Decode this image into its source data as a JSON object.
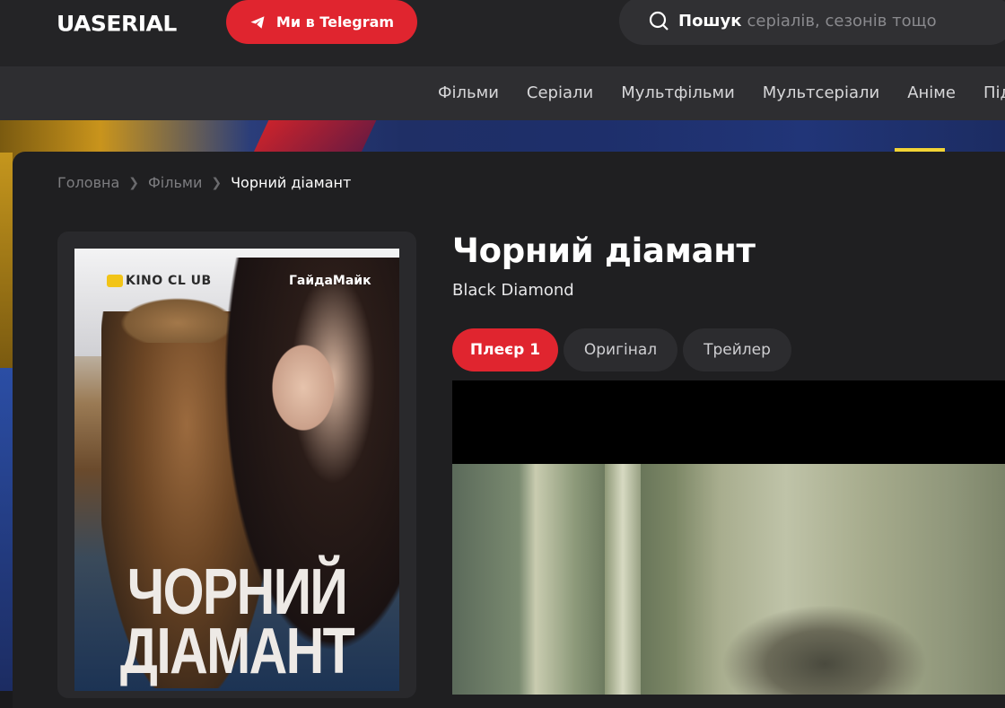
{
  "header": {
    "logo": "UASERIAL",
    "telegram_label": "Ми в Telegram",
    "search_label": "Пошук",
    "search_placeholder": "серіалів, сезонів тощо"
  },
  "nav": {
    "items": [
      "Фільми",
      "Серіали",
      "Мультфільми",
      "Мультсеріали",
      "Аніме",
      "Під"
    ]
  },
  "breadcrumb": {
    "home": "Головна",
    "section": "Фільми",
    "current": "Чорний діамант"
  },
  "poster": {
    "studio": "KINO CL UB",
    "dub": "ГайдаМайк",
    "title_line1": "ЧОРНИЙ",
    "title_line2": "ДІАМАНТ"
  },
  "movie": {
    "title": "Чорний діамант",
    "original_title": "Black Diamond"
  },
  "player_tabs": [
    {
      "label": "Плеєр 1",
      "active": true
    },
    {
      "label": "Оригінал",
      "active": false
    },
    {
      "label": "Трейлер",
      "active": false
    }
  ],
  "colors": {
    "accent": "#e0252f",
    "background": "#1f1f21",
    "topbar": "#242426"
  }
}
